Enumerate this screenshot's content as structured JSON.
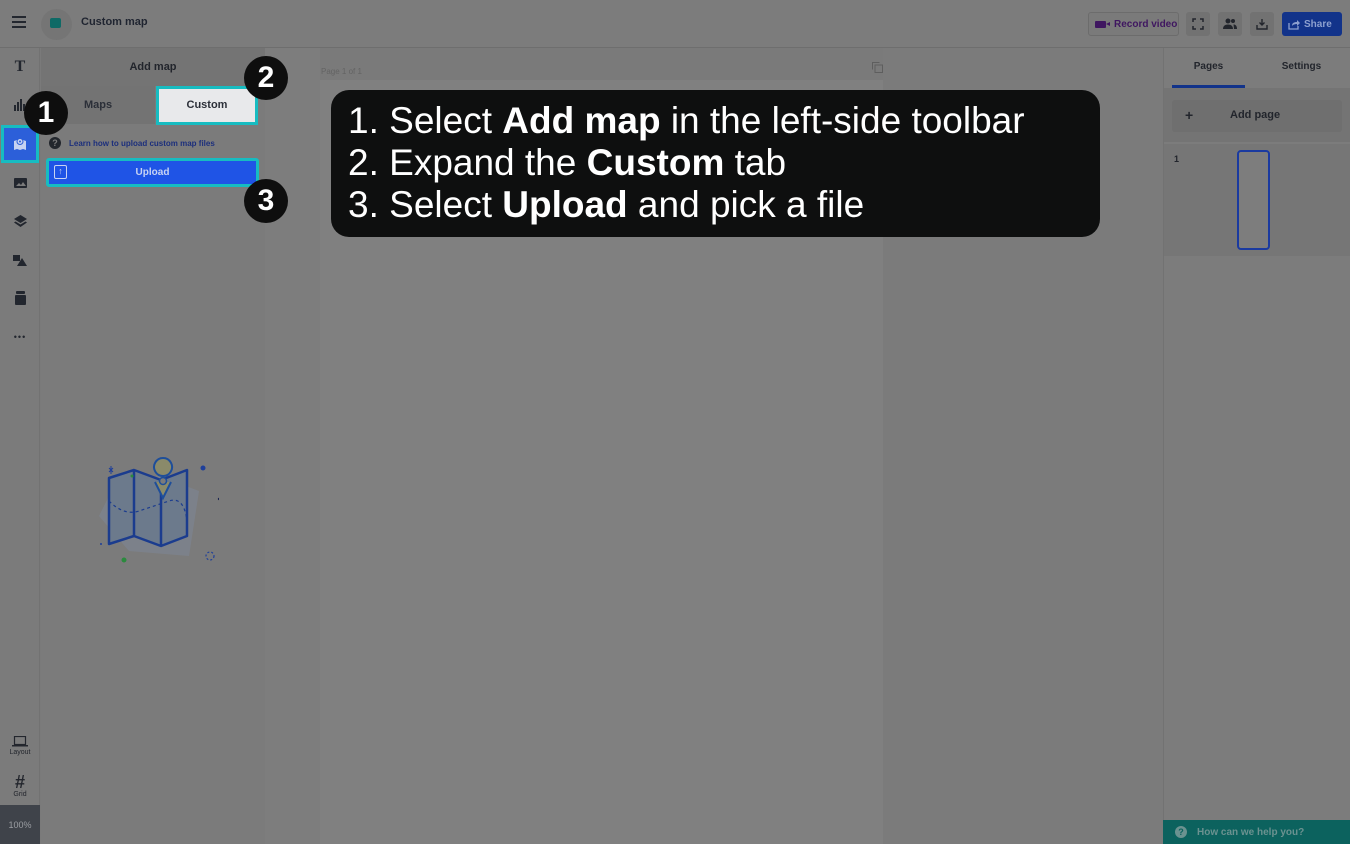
{
  "topbar": {
    "menu_icon": "hamburger-icon",
    "app_icon": "pages-icon",
    "title": "Custom map",
    "record_video": "Record video",
    "fullscreen_icon": "fullscreen-icon",
    "collaborators_icon": "users-icon",
    "download_icon": "download-icon",
    "share": "Share"
  },
  "rail": {
    "items": [
      {
        "name": "text",
        "icon": "text-icon",
        "glyph": "T"
      },
      {
        "name": "chart",
        "icon": "chart-icon",
        "glyph": "▮"
      },
      {
        "name": "add-map",
        "icon": "map-icon",
        "glyph": "⌖",
        "active": true
      },
      {
        "name": "image",
        "icon": "image-icon",
        "glyph": "▣"
      },
      {
        "name": "layers",
        "icon": "layers-icon",
        "glyph": "◈"
      },
      {
        "name": "shapes",
        "icon": "shapes-icon",
        "glyph": "◭"
      },
      {
        "name": "bucket",
        "icon": "bucket-icon",
        "glyph": "▆"
      },
      {
        "name": "more",
        "icon": "more-icon",
        "glyph": "•••"
      }
    ],
    "layout_label": "Layout",
    "grid_label": "Grid",
    "zoom": "100%"
  },
  "panel": {
    "title": "Add map",
    "tabs": [
      {
        "label": "Maps",
        "active": false
      },
      {
        "label": "Custom",
        "active": true
      }
    ],
    "help_link": "Learn how to upload custom map files",
    "upload": "Upload"
  },
  "canvas": {
    "page_label": "Page 1 of 1"
  },
  "right_panel": {
    "tabs": [
      {
        "label": "Pages",
        "active": true
      },
      {
        "label": "Settings",
        "active": false
      }
    ],
    "add_page": "Add page",
    "pages": [
      {
        "number": "1"
      }
    ]
  },
  "help_widget": "How can we help you?",
  "annotations": {
    "badges": [
      "1",
      "2",
      "3"
    ],
    "callout": [
      {
        "prefix": "1. Select ",
        "bold": "Add map",
        "suffix": " in the left-side toolbar"
      },
      {
        "prefix": "2. Expand the ",
        "bold": "Custom",
        "suffix": " tab"
      },
      {
        "prefix": "3. Select ",
        "bold": "Upload",
        "suffix": " and pick a file"
      }
    ],
    "highlight_color": "#17bcc1"
  },
  "colors": {
    "primary": "#1f54e6",
    "share": "#12338a",
    "record": "#3f1660",
    "help": "#0c625e"
  }
}
